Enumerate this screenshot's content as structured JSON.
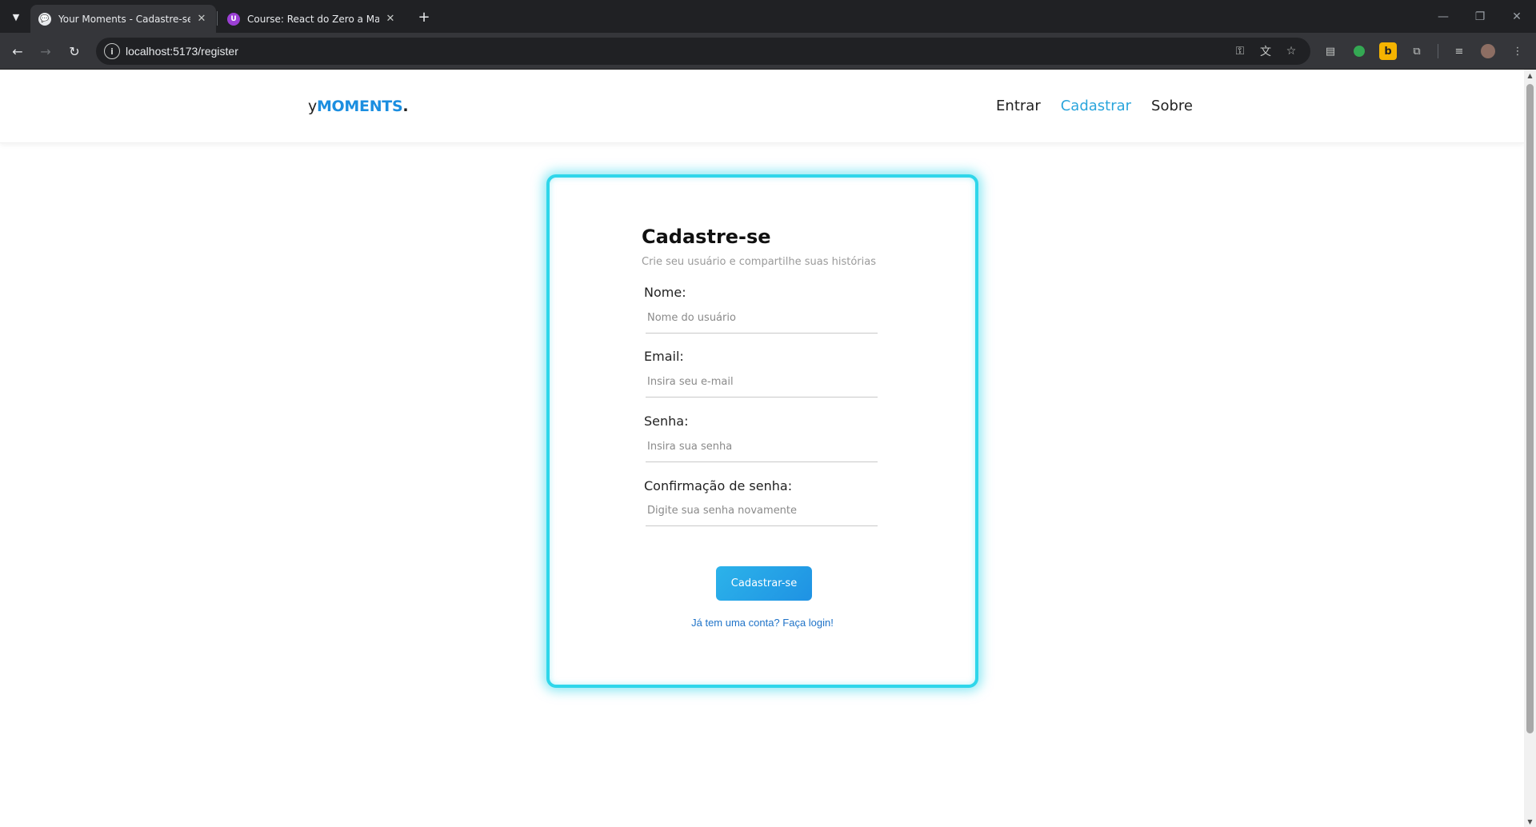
{
  "browser": {
    "tabs": [
      {
        "title": "Your Moments - Cadastre-se",
        "active": true,
        "favicon": "chat-bubble"
      },
      {
        "title": "Course: React do Zero a Maestr",
        "active": false,
        "favicon": "U"
      }
    ],
    "url": "localhost:5173/register"
  },
  "header": {
    "brand_prefix": "y",
    "brand_main": "MOMENTS",
    "brand_suffix": ".",
    "nav": [
      {
        "label": "Entrar",
        "active": false
      },
      {
        "label": "Cadastrar",
        "active": true
      },
      {
        "label": "Sobre",
        "active": false
      }
    ]
  },
  "form": {
    "title": "Cadastre-se",
    "subtitle": "Crie seu usuário e compartilhe suas histórias",
    "fields": [
      {
        "label": "Nome:",
        "placeholder": "Nome do usuário"
      },
      {
        "label": "Email:",
        "placeholder": "Insira seu e-mail"
      },
      {
        "label": "Senha:",
        "placeholder": "Insira sua senha"
      },
      {
        "label": "Confirmação de senha:",
        "placeholder": "Digite sua senha novamente"
      }
    ],
    "submit_label": "Cadastrar-se",
    "login_link": "Já tem uma conta? Faça login!"
  },
  "colors": {
    "accent": "#2aa5dc",
    "card_glow": "#2fd6ea",
    "button": "#1f92e3",
    "link": "#1f73c8"
  }
}
